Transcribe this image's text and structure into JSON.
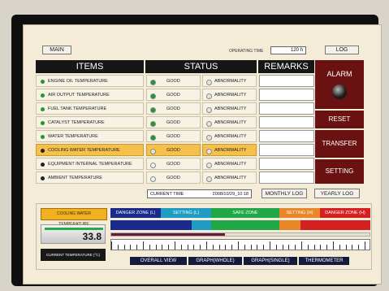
{
  "header": {
    "main_label": "MAIN",
    "operating_time_label": "OPERATING TIME",
    "operating_time_value": "120 h",
    "log_label": "LOG"
  },
  "table": {
    "headers": {
      "items": "ITEMS",
      "status": "STATUS",
      "remarks": "REMARKS"
    },
    "good_label": "GOOD",
    "abnormality_label": "ABNORMALITY",
    "rows": [
      {
        "item": "ENGINE OIL TEMPERATURE",
        "state": "good"
      },
      {
        "item": "AIR OUTPUT TEMPERATURE",
        "state": "good"
      },
      {
        "item": "FUEL TANK TEMPERATURE",
        "state": "good"
      },
      {
        "item": "CATALYST TEMPERATURE",
        "state": "good"
      },
      {
        "item": "WATER TEMPERATURE",
        "state": "good"
      },
      {
        "item": "COOLING WATER TEMPERATURE",
        "state": "highlight"
      },
      {
        "item": "EQUIPMENT INTERNAL TEMPERATURE",
        "state": "off"
      },
      {
        "item": "AMBIENT TEMPERATURE",
        "state": "off"
      }
    ]
  },
  "side_panel": {
    "alarm_label": "ALARM",
    "reset_label": "RESET",
    "transfer_label": "TRANSFER",
    "setting_label": "SETTING"
  },
  "time_bar": {
    "current_time_label": "CURRENT TIME",
    "current_time_value": "2008/10/29_10:18",
    "monthly_log_label": "MONTHLY LOG",
    "yearly_log_label": "YEARLY LOG"
  },
  "gauge": {
    "title": "COOLING WATER TEMPERATURE",
    "value": "33.8",
    "current_temp_label": "CURRENT TEMPERATURE (°C)",
    "zones": {
      "danger_low": "DANGER ZONE (L)",
      "setting_low": "SETTING (L)",
      "safe": "SAFE ZONE",
      "setting_high": "SETTING (H)",
      "danger_high": "DANGER ZONE (H)"
    },
    "level_fraction": 0.44
  },
  "nav": {
    "overall_view": "OVERALL VIEW",
    "graph_whole": "GRAPH(WHOLE)",
    "graph_single": "GRAPH(SINGLE)",
    "thermometer": "THERMOMETER"
  },
  "colors": {
    "good": "#1e9a2a",
    "danger": "#d42020",
    "setting": "#1e9cc4",
    "safe": "#20a848",
    "setting_high": "#e8872a",
    "navy": "#1a2a8a"
  }
}
